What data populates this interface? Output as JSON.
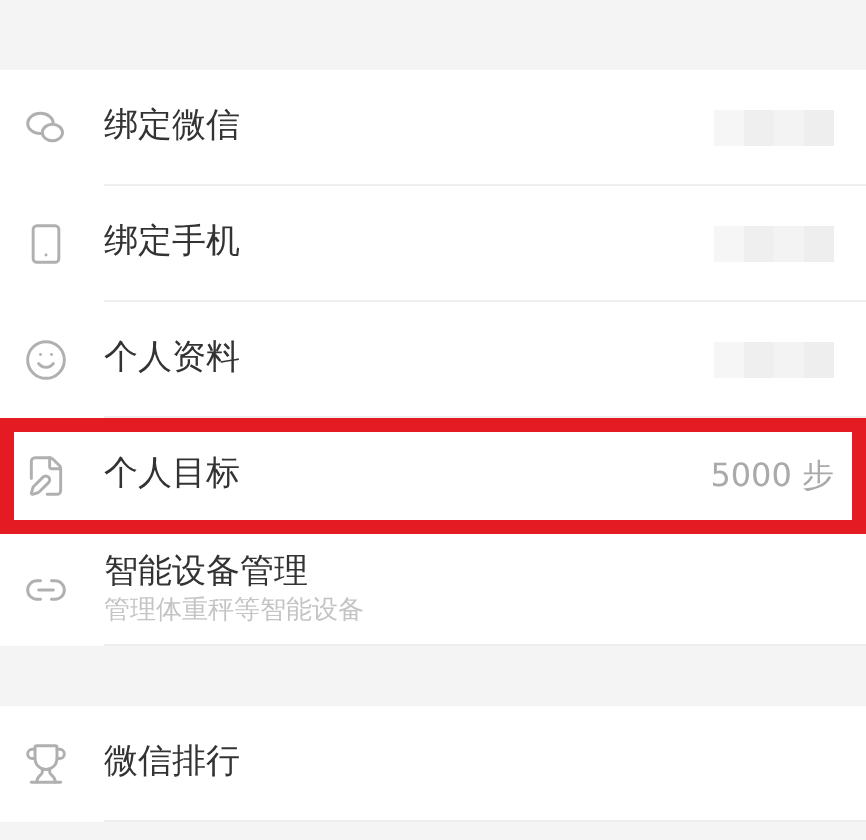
{
  "groups": [
    {
      "items": [
        {
          "label": "绑定微信",
          "redacted": true,
          "highlighted": false
        },
        {
          "label": "绑定手机",
          "redacted": true,
          "highlighted": false
        },
        {
          "label": "个人资料",
          "redacted": true,
          "highlighted": false
        },
        {
          "label": "个人目标",
          "value": "5000 步",
          "redacted": false,
          "highlighted": true
        },
        {
          "label": "智能设备管理",
          "subtitle": "管理体重秤等智能设备",
          "redacted": false,
          "highlighted": false
        }
      ]
    },
    {
      "items": [
        {
          "label": "微信排行",
          "redacted": false,
          "highlighted": false
        }
      ]
    }
  ]
}
